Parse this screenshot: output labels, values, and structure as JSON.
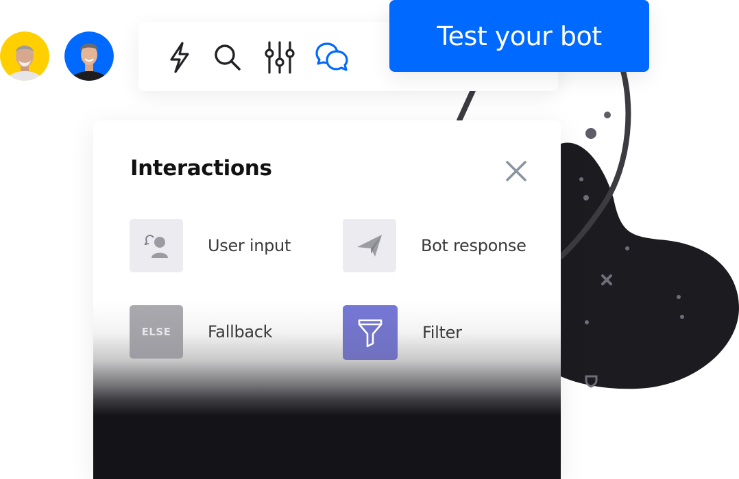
{
  "avatars": [
    {
      "name": "user-avatar-1",
      "background": "#ffcf00"
    },
    {
      "name": "user-avatar-2",
      "background": "#0069ff"
    }
  ],
  "toolbar": {
    "icons": [
      {
        "name": "lightning-icon",
        "label": "Triggers",
        "active": false
      },
      {
        "name": "search-icon",
        "label": "Search",
        "active": false
      },
      {
        "name": "sliders-icon",
        "label": "Settings",
        "active": false
      },
      {
        "name": "chat-bubbles-icon",
        "label": "Interactions",
        "active": true
      }
    ],
    "active_color": "#0069ff",
    "icon_color": "#222226"
  },
  "test_button": {
    "label": "Test your bot",
    "color": "#0069ff"
  },
  "panel": {
    "title": "Interactions",
    "close_icon": "close-icon",
    "items": [
      {
        "label": "User input",
        "icon": "user-input-icon"
      },
      {
        "label": "Bot response",
        "icon": "paper-plane-icon"
      },
      {
        "label": "Fallback",
        "icon": "else-icon",
        "icon_text": "ELSE"
      },
      {
        "label": "Filter",
        "icon": "filter-icon"
      }
    ]
  }
}
